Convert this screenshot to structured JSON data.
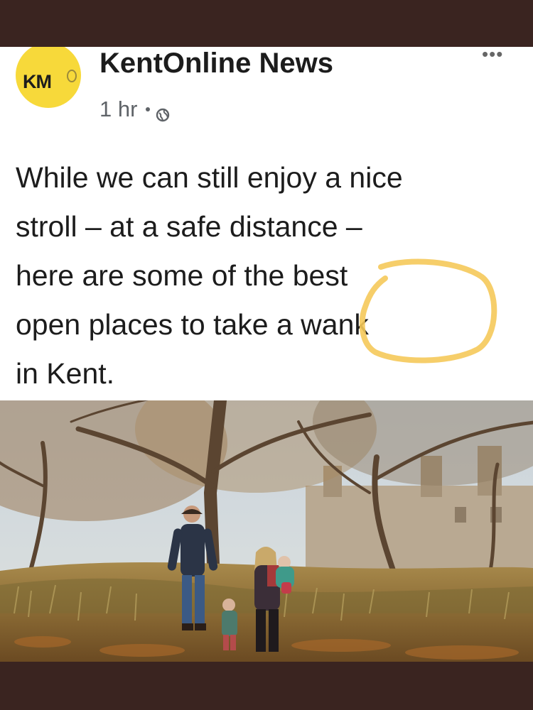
{
  "post": {
    "page_name": "KentOnline News",
    "avatar_text": "KM",
    "timestamp": "1 hr",
    "privacy_icon": "globe-icon",
    "more_label": "•••",
    "caption_lines": [
      "While we can still enjoy a nice",
      "stroll – at a safe distance –",
      "here are some of the best",
      "open places to take a wank",
      "in Kent."
    ]
  },
  "colors": {
    "frame": "#3a2420",
    "avatar_yellow": "#f7d93a",
    "circle_highlight": "#f5c95a",
    "text": "#1c1c1c",
    "meta_text": "#5f6368"
  }
}
